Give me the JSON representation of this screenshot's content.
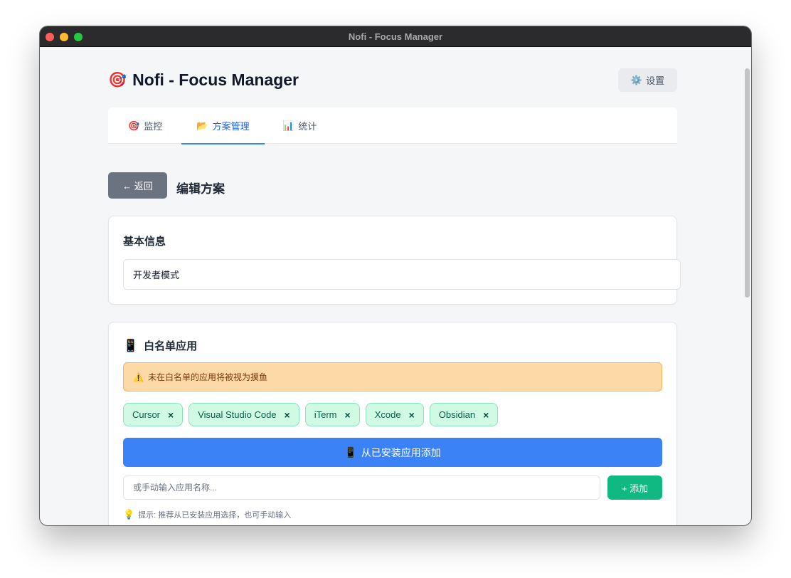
{
  "window": {
    "title": "Nofi - Focus Manager"
  },
  "header": {
    "logo_icon": "🎯",
    "title": "Nofi - Focus Manager",
    "settings_icon": "⚙️",
    "settings_label": "设置"
  },
  "tabs": [
    {
      "icon": "🎯",
      "label": "监控",
      "active": false
    },
    {
      "icon": "📂",
      "label": "方案管理",
      "active": true
    },
    {
      "icon": "📊",
      "label": "统计",
      "active": false
    }
  ],
  "editor": {
    "back_label": "← 返回",
    "title": "编辑方案"
  },
  "basic_info": {
    "title": "基本信息",
    "name_value": "开发者模式"
  },
  "whitelist": {
    "icon": "📱",
    "title": "白名单应用",
    "warning_icon": "⚠️",
    "warning": "未在白名单的应用将被视为摸鱼",
    "apps": [
      "Cursor",
      "Visual Studio Code",
      "iTerm",
      "Xcode",
      "Obsidian"
    ],
    "remove_symbol": "×",
    "add_installed_icon": "📱",
    "add_installed_label": "从已安装应用添加",
    "manual_placeholder": "或手动输入应用名称...",
    "add_label": "+ 添加",
    "hint_icon": "💡",
    "hint": "提示: 推荐从已安装应用选择，也可手动输入"
  },
  "colors": {
    "primary": "#3b82f6",
    "success": "#10b981",
    "warning_bg": "#fdd9a8",
    "tag_bg": "#d1fae5",
    "back_btn": "#6b7280"
  }
}
